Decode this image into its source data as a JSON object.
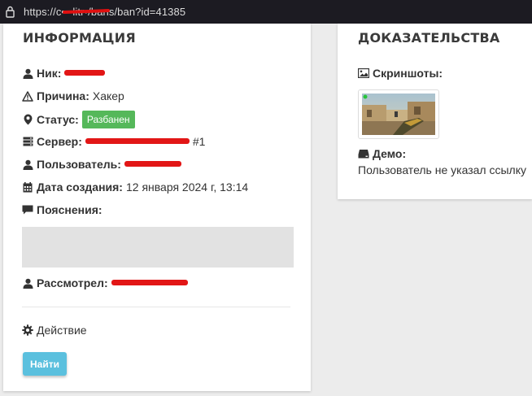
{
  "browser": {
    "url_prefix": "https://",
    "url_host_redacted": "c•••litr•",
    "url_path": "/bans/ban?id=41385"
  },
  "info": {
    "title": "ИНФОРМАЦИЯ",
    "nick_label": "Ник:",
    "reason_label": "Причина:",
    "reason_value": "Хакер",
    "status_label": "Статус:",
    "status_value": "Разбанен",
    "server_label": "Сервер:",
    "server_suffix": "#1",
    "user_label": "Пользователь:",
    "created_label": "Дата создания:",
    "created_value": "12 января 2024 г, 13:14",
    "notes_label": "Пояснения:",
    "reviewed_label": "Рассмотрел:",
    "action_label": "Действие",
    "find_button": "Найти"
  },
  "proof": {
    "title": "ДОКАЗАТЕЛЬСТВА",
    "screenshots_label": "Скриншоты:",
    "demo_label": "Демо:",
    "demo_text": "Пользователь не указал ссылку"
  },
  "colors": {
    "status_badge": "#55b85a",
    "find_button": "#5bc0de",
    "redaction": "#e21616"
  },
  "icons": [
    "lock-icon",
    "user-icon",
    "warning-icon",
    "map-marker-icon",
    "server-icon",
    "calendar-icon",
    "comment-icon",
    "gear-icon",
    "image-icon",
    "hdd-icon"
  ]
}
